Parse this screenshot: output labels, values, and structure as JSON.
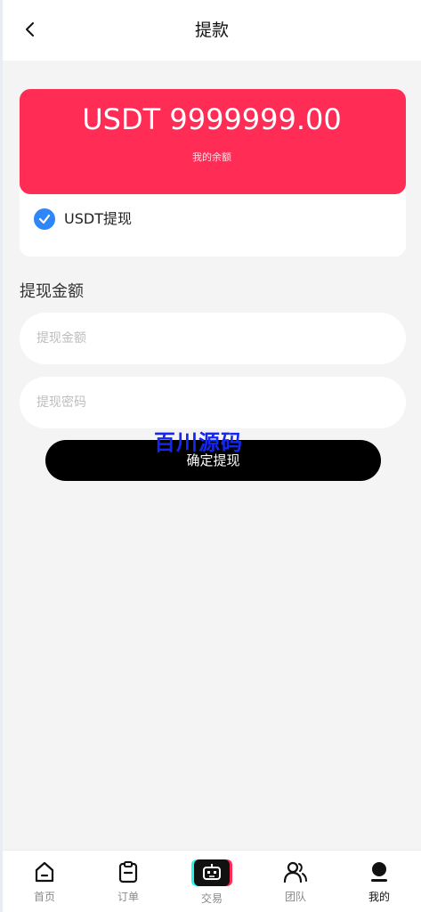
{
  "header": {
    "title": "提款",
    "back_icon": "chevron-left-icon"
  },
  "balance": {
    "amount": "USDT 9999999.00",
    "label": "我的余额",
    "background_color": "#ff2c55"
  },
  "withdraw_method": {
    "label": "USDT提现",
    "checked": true,
    "check_color": "#2f86f6"
  },
  "form": {
    "section_title": "提现金额",
    "amount_placeholder": "提现金额",
    "amount_value": "",
    "password_placeholder": "提现密码",
    "password_value": "",
    "submit_label": "确定提现"
  },
  "watermark": "百川源码",
  "tabbar": {
    "items": [
      {
        "label": "首页",
        "icon": "home-icon",
        "active": false
      },
      {
        "label": "订单",
        "icon": "clipboard-icon",
        "active": false
      },
      {
        "label": "交易",
        "icon": "robot-icon",
        "active": false
      },
      {
        "label": "团队",
        "icon": "team-icon",
        "active": false
      },
      {
        "label": "我的",
        "icon": "user-icon",
        "active": true
      }
    ]
  }
}
